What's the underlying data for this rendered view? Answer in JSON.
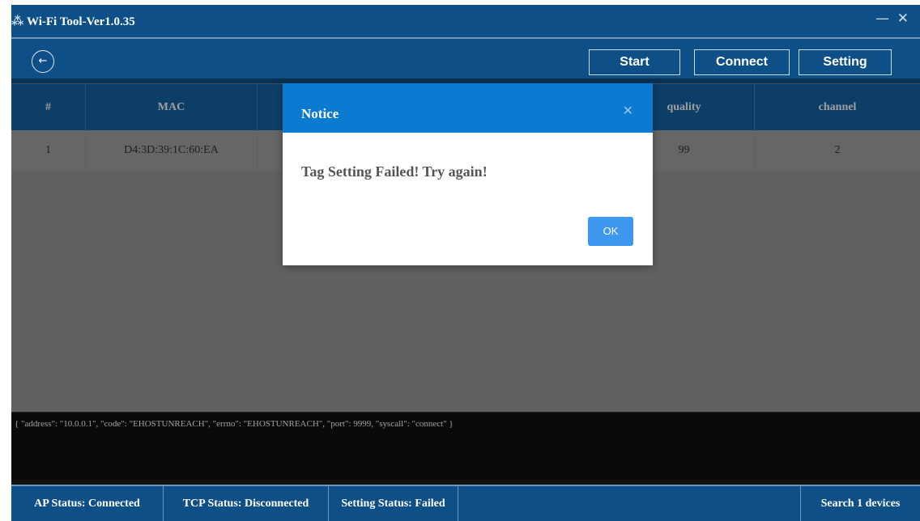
{
  "window": {
    "title": "Wi-Fi Tool-Ver1.0.35",
    "logo_glyph": "⁂",
    "minimize_glyph": "—",
    "close_glyph": "✕"
  },
  "toolbar": {
    "back_glyph": "←",
    "start_label": "Start",
    "connect_label": "Connect",
    "setting_label": "Setting"
  },
  "table": {
    "columns": [
      "#",
      "MAC",
      "",
      "quality",
      "channel"
    ],
    "rows": [
      [
        "1",
        "D4:3D:39:1C:60:EA",
        "",
        "99",
        "2"
      ]
    ]
  },
  "log": {
    "text": "{ \"address\": \"10.0.0.1\", \"code\": \"EHOSTUNREACH\", \"errno\": \"EHOSTUNREACH\", \"port\": 9999, \"syscall\": \"connect\" }"
  },
  "status": {
    "ap": "AP Status: Connected",
    "tcp": "TCP Status: Disconnected",
    "setting": "Setting Status: Failed",
    "search": "Search 1 devices"
  },
  "modal": {
    "title": "Notice",
    "close_glyph": "✕",
    "message": "Tag Setting Failed! Try again!",
    "ok_label": "OK"
  },
  "colors": {
    "primary": "#0d4f86",
    "table_header": "#1664a8",
    "modal_header": "#0b7ad1",
    "ok_button": "#3f98f0"
  }
}
